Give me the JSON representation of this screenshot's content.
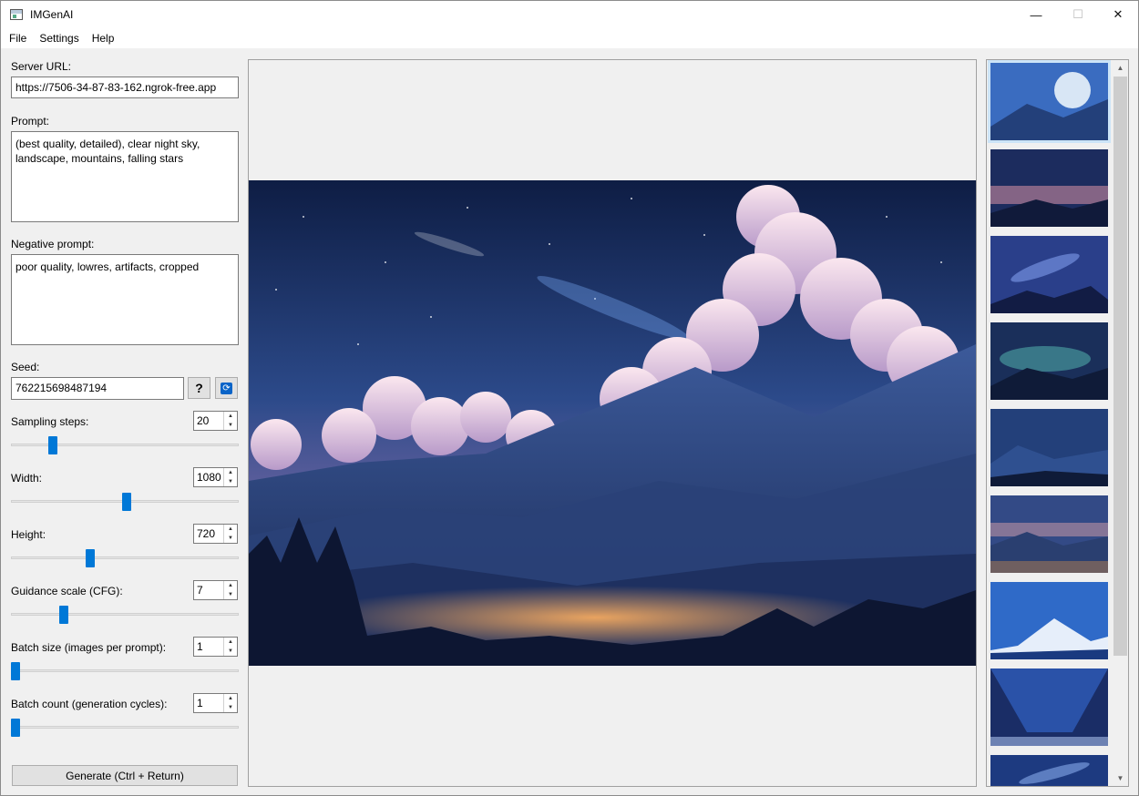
{
  "window": {
    "title": "IMGenAI"
  },
  "menu": [
    "File",
    "Settings",
    "Help"
  ],
  "form": {
    "server_url_label": "Server URL:",
    "server_url_value": "https://7506-34-87-83-162.ngrok-free.app",
    "prompt_label": "Prompt:",
    "prompt_value": "(best quality, detailed), clear night sky,\nlandscape, mountains, falling stars",
    "negative_label": "Negative prompt:",
    "negative_value": "poor quality, lowres, artifacts, cropped",
    "seed_label": "Seed:",
    "seed_value": "762215698487194",
    "sampling_label": "Sampling steps:",
    "sampling_value": "20",
    "sampling_level": 0.17,
    "width_label": "Width:",
    "width_value": "1080",
    "width_level": 0.51,
    "height_label": "Height:",
    "height_value": "720",
    "height_level": 0.34,
    "cfg_label": "Guidance scale (CFG):",
    "cfg_value": "7",
    "cfg_level": 0.22,
    "batch_size_label": "Batch size (images per prompt):",
    "batch_size_value": "1",
    "batch_size_level": 0.0,
    "batch_count_label": "Batch count (generation cycles):",
    "batch_count_value": "1",
    "batch_count_level": 0.0,
    "generate_label": "Generate (Ctrl + Return)"
  },
  "icons": {
    "help": "help-icon",
    "refresh": "refresh-icon",
    "accent": "#0078d7"
  },
  "gallery": {
    "count": 9,
    "selected_index": 0
  }
}
